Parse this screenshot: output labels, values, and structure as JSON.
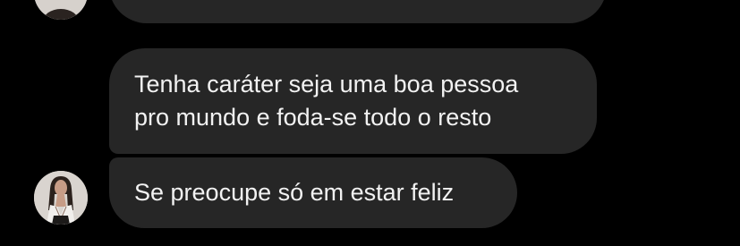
{
  "colors": {
    "background": "#000000",
    "bubble": "#262626",
    "text": "#f2f2f2"
  },
  "messages": [
    {
      "text": "Tenha caráter seja uma boa pessoa\npro mundo e foda-se todo o resto"
    },
    {
      "text": "Se preocupe só em estar feliz"
    }
  ],
  "avatar": {
    "icon": "profile-photo"
  }
}
